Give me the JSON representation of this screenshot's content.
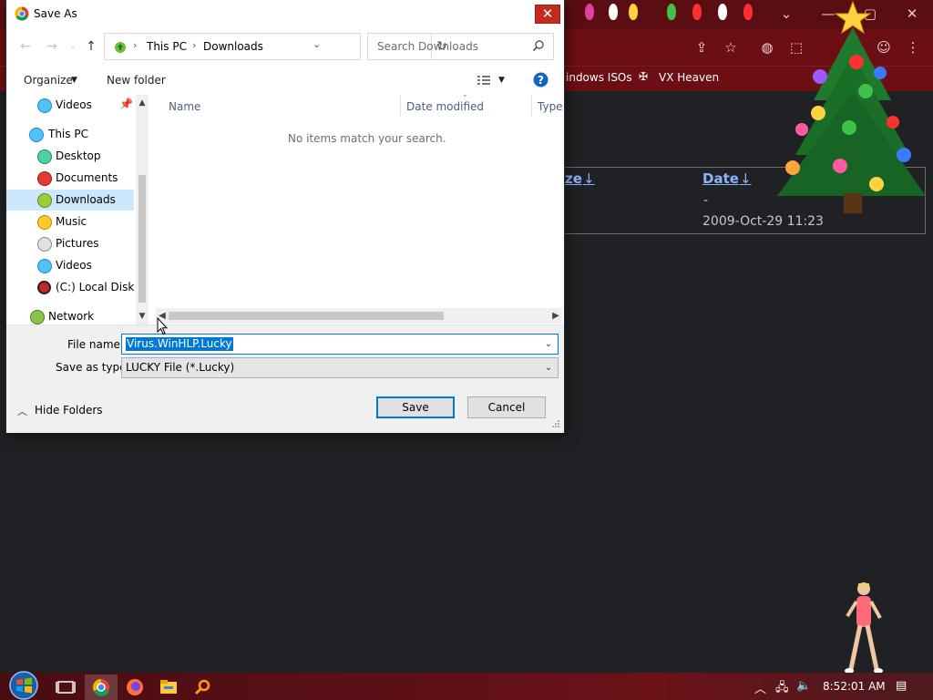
{
  "browser": {
    "bookmarks": [
      "indows ISOs",
      "VX Heaven"
    ],
    "table": {
      "col_size": "ze",
      "col_date": "Date",
      "sort_arrow": "↓",
      "row1_date": "-",
      "row2_date": "2009-Oct-29 11:23"
    },
    "accent": "#8ab4f8"
  },
  "dialog": {
    "title": "Save As",
    "address": {
      "segments": [
        "This PC",
        "Downloads"
      ]
    },
    "search": {
      "placeholder": "Search Downloads"
    },
    "commands": {
      "organize": "Organize",
      "new_folder": "New folder"
    },
    "nav_pane": [
      {
        "label": "Videos",
        "icon": "videos-icon",
        "selected": false
      },
      {
        "label": "This PC",
        "icon": "this-pc-icon",
        "selected": false
      },
      {
        "label": "Desktop",
        "icon": "desktop-icon",
        "selected": false
      },
      {
        "label": "Documents",
        "icon": "documents-icon",
        "selected": false
      },
      {
        "label": "Downloads",
        "icon": "downloads-icon",
        "selected": true
      },
      {
        "label": "Music",
        "icon": "music-icon",
        "selected": false
      },
      {
        "label": "Pictures",
        "icon": "pictures-icon",
        "selected": false
      },
      {
        "label": "Videos",
        "icon": "videos-icon",
        "selected": false
      },
      {
        "label": "(C:) Local Disk",
        "icon": "local-disk-icon",
        "selected": false
      },
      {
        "label": "Network",
        "icon": "network-icon",
        "selected": false
      }
    ],
    "columns": [
      "Name",
      "Date modified",
      "Type"
    ],
    "empty_message": "No items match your search.",
    "file_name_label": "File name:",
    "file_name_value": "Virus.WinHLP.Lucky",
    "save_as_type_label": "Save as type:",
    "save_as_type_value": "LUCKY File (*.Lucky)",
    "hide_folders": "Hide Folders",
    "save": "Save",
    "cancel": "Cancel",
    "accent": "#0078d7",
    "close_color": "#c42b1c"
  },
  "taskbar": {
    "clock": "8:52:01 AM",
    "apps": [
      "task-view-icon",
      "chrome-icon",
      "firefox-icon",
      "file-explorer-icon",
      "search-app-icon"
    ]
  }
}
